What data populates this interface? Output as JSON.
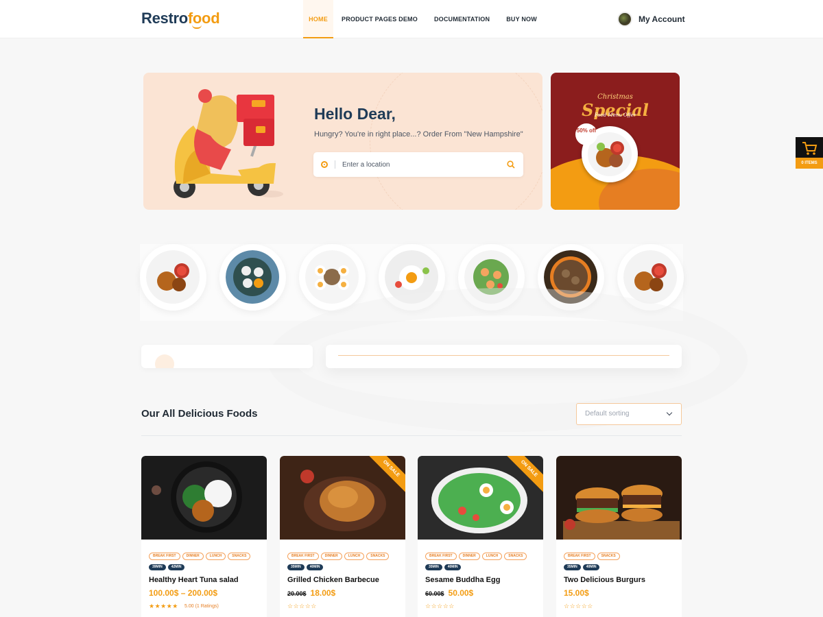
{
  "header": {
    "logo_part1": "Restro",
    "logo_part2": "food",
    "nav": [
      "HOME",
      "PRODUCT PAGES DEMO",
      "DOCUMENTATION",
      "BUY NOW"
    ],
    "account": "My Account"
  },
  "hero": {
    "greeting": "Hello Dear,",
    "subtitle": "Hungry? You're in right place...? Order From \"New Hampshire\"",
    "search_placeholder": "Enter a location"
  },
  "promo": {
    "christmas": "Christmas",
    "special": "Special",
    "offer": "Food Menu Offer",
    "badge": "50% off"
  },
  "cart": {
    "count_label": "0 ITEMS"
  },
  "section": {
    "title": "Our All Delicious Foods",
    "sort": "Default sorting"
  },
  "products": [
    {
      "name": "Healthy Heart Tuna salad",
      "price": "100.00$ – 200.00$",
      "old_price": "",
      "rating_text": "5.00 (1 Ratings)",
      "tags": [
        "BREAK FIRST",
        "DINNER",
        "LUNCH",
        "SNACKS"
      ],
      "times": [
        "39MIN",
        "42MIN"
      ],
      "on_sale": false
    },
    {
      "name": "Grilled Chicken Barbecue",
      "price": "18.00$",
      "old_price": "20.00$",
      "rating_text": "",
      "tags": [
        "BREAK FIRST",
        "DINNER",
        "LUNCH",
        "SNACKS"
      ],
      "times": [
        "35MIN",
        "40MIN"
      ],
      "on_sale": true,
      "sale_label": "ON SALE"
    },
    {
      "name": "Sesame Buddha Egg",
      "price": "50.00$",
      "old_price": "60.00$",
      "rating_text": "",
      "tags": [
        "BREAK FIRST",
        "DINNER",
        "LUNCH",
        "SNACKS"
      ],
      "times": [
        "35MIN",
        "40MIN"
      ],
      "on_sale": true,
      "sale_label": "ON SALE"
    },
    {
      "name": "Two Delicious Burgurs",
      "price": "15.00$",
      "old_price": "",
      "rating_text": "",
      "tags": [
        "BREAK FIRST",
        "SNACKS"
      ],
      "times": [
        "35MIN",
        "40MIN"
      ],
      "on_sale": false
    }
  ],
  "colors": {
    "accent": "#f39c12",
    "navy": "#1f3b57",
    "hero_bg": "#fbe4d4",
    "promo_bg": "#8b1d1d"
  }
}
